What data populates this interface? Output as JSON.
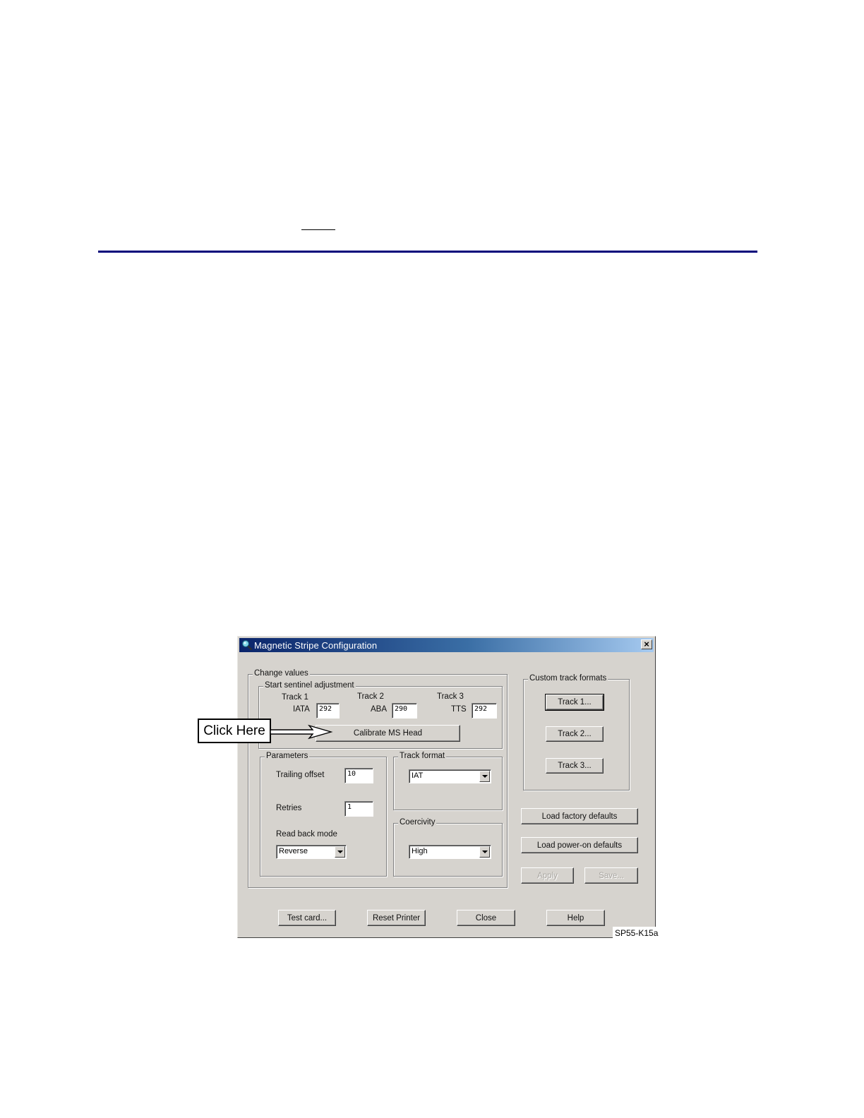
{
  "dialog": {
    "title": "Magnetic Stripe Configuration",
    "close_label": "×",
    "change_values": {
      "label": "Change values",
      "start_sentinel": {
        "label": "Start sentinel adjustment",
        "tracks": [
          {
            "header": "Track 1",
            "format": "IATA",
            "value": "292"
          },
          {
            "header": "Track 2",
            "format": "ABA",
            "value": "290"
          },
          {
            "header": "Track 3",
            "format": "TTS",
            "value": "292"
          }
        ],
        "calibrate_label": "Calibrate MS Head"
      },
      "parameters": {
        "label": "Parameters",
        "trailing_offset_label": "Trailing offset",
        "trailing_offset_value": "10",
        "retries_label": "Retries",
        "retries_value": "1",
        "read_back_mode_label": "Read back mode",
        "read_back_mode_value": "Reverse"
      },
      "track_format": {
        "label": "Track format",
        "value": "IAT"
      },
      "coercivity": {
        "label": "Coercivity",
        "value": "High"
      }
    },
    "custom_track_formats": {
      "label": "Custom track formats",
      "buttons": [
        "Track 1...",
        "Track 2...",
        "Track 3..."
      ]
    },
    "load_factory_label": "Load factory defaults",
    "load_poweron_label": "Load power-on defaults",
    "apply_label": "Apply",
    "save_label": "Save...",
    "bottom_buttons": {
      "test_card": "Test card...",
      "reset_printer": "Reset Printer",
      "close": "Close",
      "help": "Help"
    }
  },
  "callout": {
    "text": "Click Here"
  },
  "figure_id": "SP55-K15a"
}
